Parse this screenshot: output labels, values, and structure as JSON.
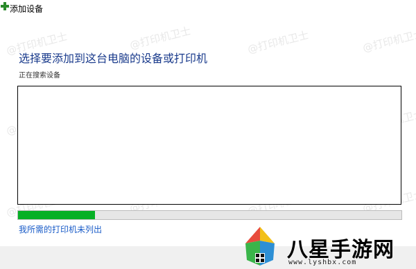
{
  "window": {
    "title": "添加设备",
    "icon": "add-device-icon"
  },
  "main": {
    "heading": "选择要添加到这台电脑的设备或打印机",
    "status": "正在搜索设备",
    "progress": 0.2,
    "progress_color": "#06b025",
    "missing_printer_link": "我所需的打印机未列出"
  },
  "watermark": {
    "text": "@打印机卫士"
  },
  "corner_logo": {
    "name": "八星手游网",
    "url": "www.lyshbx.com"
  }
}
